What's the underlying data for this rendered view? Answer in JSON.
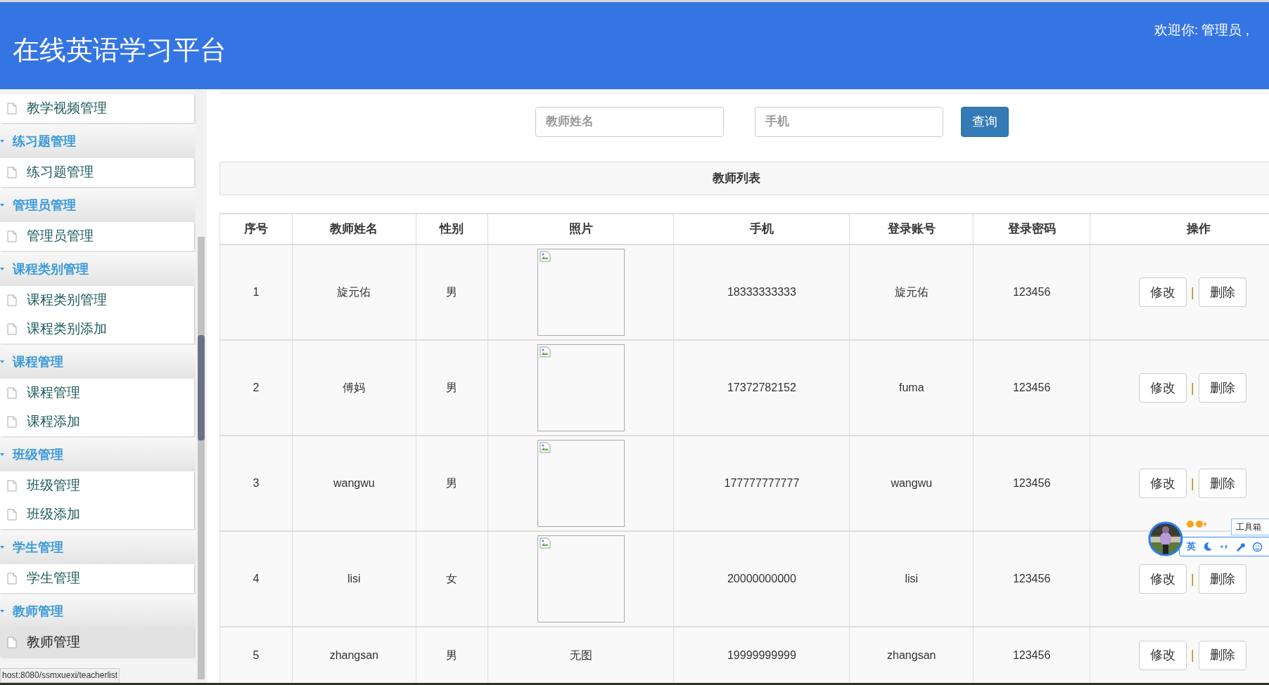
{
  "header": {
    "title": "在线英语学习平台",
    "welcome": "欢迎你: 管理员 ,"
  },
  "sidebar": {
    "groups": [
      {
        "items": [
          {
            "label": "教学视频管理",
            "selected": false
          }
        ]
      },
      {
        "title": "练习题管理",
        "expanded": true,
        "items": [
          {
            "label": "练习题管理",
            "selected": false
          }
        ]
      },
      {
        "title": "管理员管理",
        "expanded": true,
        "items": [
          {
            "label": "管理员管理",
            "selected": false
          }
        ]
      },
      {
        "title": "课程类别管理",
        "expanded": true,
        "items": [
          {
            "label": "课程类别管理",
            "selected": false
          },
          {
            "label": "课程类别添加",
            "selected": false
          }
        ]
      },
      {
        "title": "课程管理",
        "expanded": true,
        "items": [
          {
            "label": "课程管理",
            "selected": false
          },
          {
            "label": "课程添加",
            "selected": false
          }
        ]
      },
      {
        "title": "班级管理",
        "expanded": true,
        "items": [
          {
            "label": "班级管理",
            "selected": false
          },
          {
            "label": "班级添加",
            "selected": false
          }
        ]
      },
      {
        "title": "学生管理",
        "expanded": true,
        "items": [
          {
            "label": "学生管理",
            "selected": false
          }
        ]
      },
      {
        "title": "教师管理",
        "expanded": true,
        "items": [
          {
            "label": "教师管理",
            "selected": true
          }
        ]
      }
    ]
  },
  "search": {
    "name_placeholder": "教师姓名",
    "phone_placeholder": "手机",
    "button": "查询"
  },
  "panel_title": "教师列表",
  "table": {
    "columns": [
      "序号",
      "教师姓名",
      "性别",
      "照片",
      "手机",
      "登录账号",
      "登录密码",
      "操作"
    ],
    "rows": [
      {
        "no": "1",
        "name": "旋元佑",
        "gender": "男",
        "photo": {
          "kind": "broken_image"
        },
        "phone": "18333333333",
        "account": "旋元佑",
        "password": "123456",
        "actions": [
          "修改",
          "|",
          "删除"
        ]
      },
      {
        "no": "2",
        "name": "傅妈",
        "gender": "男",
        "photo": {
          "kind": "broken_image"
        },
        "phone": "17372782152",
        "account": "fuma",
        "password": "123456",
        "actions": [
          "修改",
          "|",
          "删除"
        ]
      },
      {
        "no": "3",
        "name": "wangwu",
        "gender": "男",
        "photo": {
          "kind": "broken_image"
        },
        "phone": "177777777777",
        "account": "wangwu",
        "password": "123456",
        "actions": [
          "修改",
          "|",
          "删除"
        ]
      },
      {
        "no": "4",
        "name": "lisi",
        "gender": "女",
        "photo": {
          "kind": "broken_image"
        },
        "phone": "20000000000",
        "account": "lisi",
        "password": "123456",
        "actions": [
          "修改",
          "|",
          "删除"
        ]
      },
      {
        "no": "5",
        "name": "zhangsan",
        "gender": "男",
        "photo": {
          "kind": "text",
          "text": "无图"
        },
        "phone": "19999999999",
        "account": "zhangsan",
        "password": "123456",
        "actions": [
          "修改",
          "|",
          "删除"
        ]
      }
    ]
  },
  "status_url": "host:8080/ssmxuexi/teacherlist",
  "ime_toolbar": {
    "mode": "英",
    "toolbox_label": "工具箱"
  }
}
